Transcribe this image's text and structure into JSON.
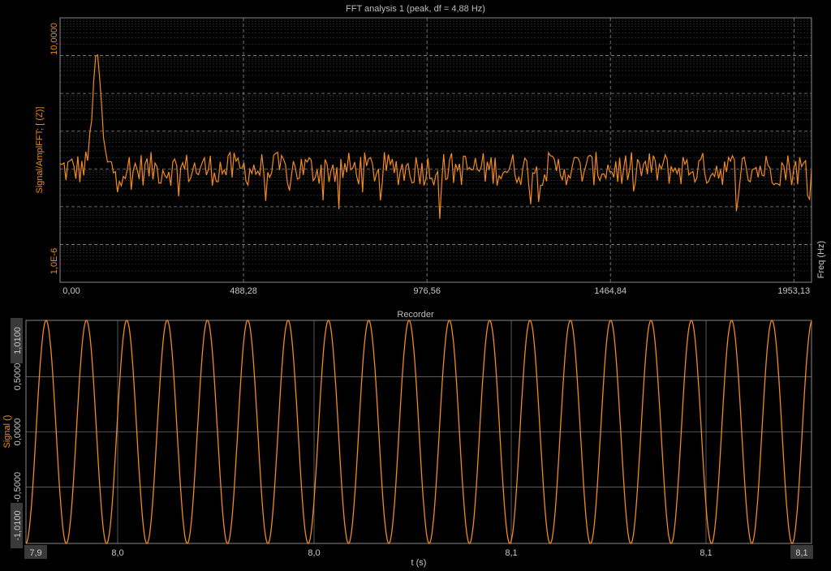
{
  "colors": {
    "signal": "#f28a1e",
    "background": "#000000",
    "grid": "#8a8a8a",
    "frame": "#9a9a9a"
  },
  "fft": {
    "chart_data": {
      "type": "line",
      "title": "FFT analysis 1 (peak, df = 4,88 Hz)",
      "xlabel": "Freq (Hz)",
      "ylabel": "Signal/AmplFFT; [ (Z)]",
      "yscale": "log",
      "xlim": [
        0,
        2000
      ],
      "ylim": [
        1e-06,
        10
      ],
      "x_ticks": [
        "0,00",
        "488,28",
        "976,56",
        "1464,84",
        "1953,13"
      ],
      "y_ticks": [
        "10,0000",
        "1,0E-6"
      ],
      "grid": true,
      "peak": {
        "x": 97.7,
        "y": 1.2
      },
      "series": [
        {
          "values_note_free": true
        }
      ]
    }
  },
  "recorder": {
    "chart_data": {
      "type": "line",
      "title": "Recorder",
      "xlabel": "t (s)",
      "ylabel": "Signal ()",
      "xlim": [
        7.9,
        8.1
      ],
      "ylim": [
        -1.01,
        1.01
      ],
      "x_ticks": [
        "7,9",
        "8,0",
        "8,0",
        "8,1",
        "8,1",
        "8,1"
      ],
      "y_ticks": [
        "1,0100",
        "0,5000",
        "0,0000",
        "-0,5000",
        "-1,0100"
      ],
      "grid": true,
      "series": [
        {
          "waveform": "sine",
          "amplitude": 1.01,
          "frequency_hz": 97.7
        }
      ]
    }
  }
}
